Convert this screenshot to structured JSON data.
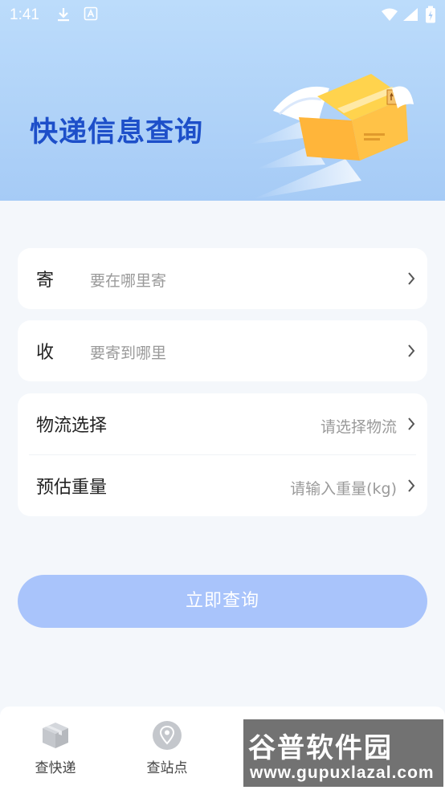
{
  "status_bar": {
    "time": "1:41",
    "icons": [
      "download-icon",
      "sim-a-icon",
      "wifi-icon",
      "signal-icon",
      "battery-icon"
    ]
  },
  "hero": {
    "title": "快递信息查询",
    "illustration": "winged-parcel-box"
  },
  "form": {
    "send": {
      "label": "寄",
      "placeholder": "要在哪里寄"
    },
    "receive": {
      "label": "收",
      "placeholder": "要寄到哪里"
    },
    "logistics": {
      "label": "物流选择",
      "hint": "请选择物流"
    },
    "weight": {
      "label": "预估重量",
      "hint": "请输入重量(kg)"
    }
  },
  "submit": {
    "label": "立即查询"
  },
  "bottom_nav": {
    "items": [
      {
        "label": "查快递",
        "icon": "box-icon"
      },
      {
        "label": "查站点",
        "icon": "location-pin-icon"
      }
    ]
  },
  "watermark": {
    "title": "谷普软件园",
    "url": "www.gupuxlazal.com"
  },
  "colors": {
    "accent": "#1d4fc9",
    "hero_bg": "#a6cbf6",
    "button": "#a9c4fb",
    "page_bg": "#f4f7fb"
  }
}
